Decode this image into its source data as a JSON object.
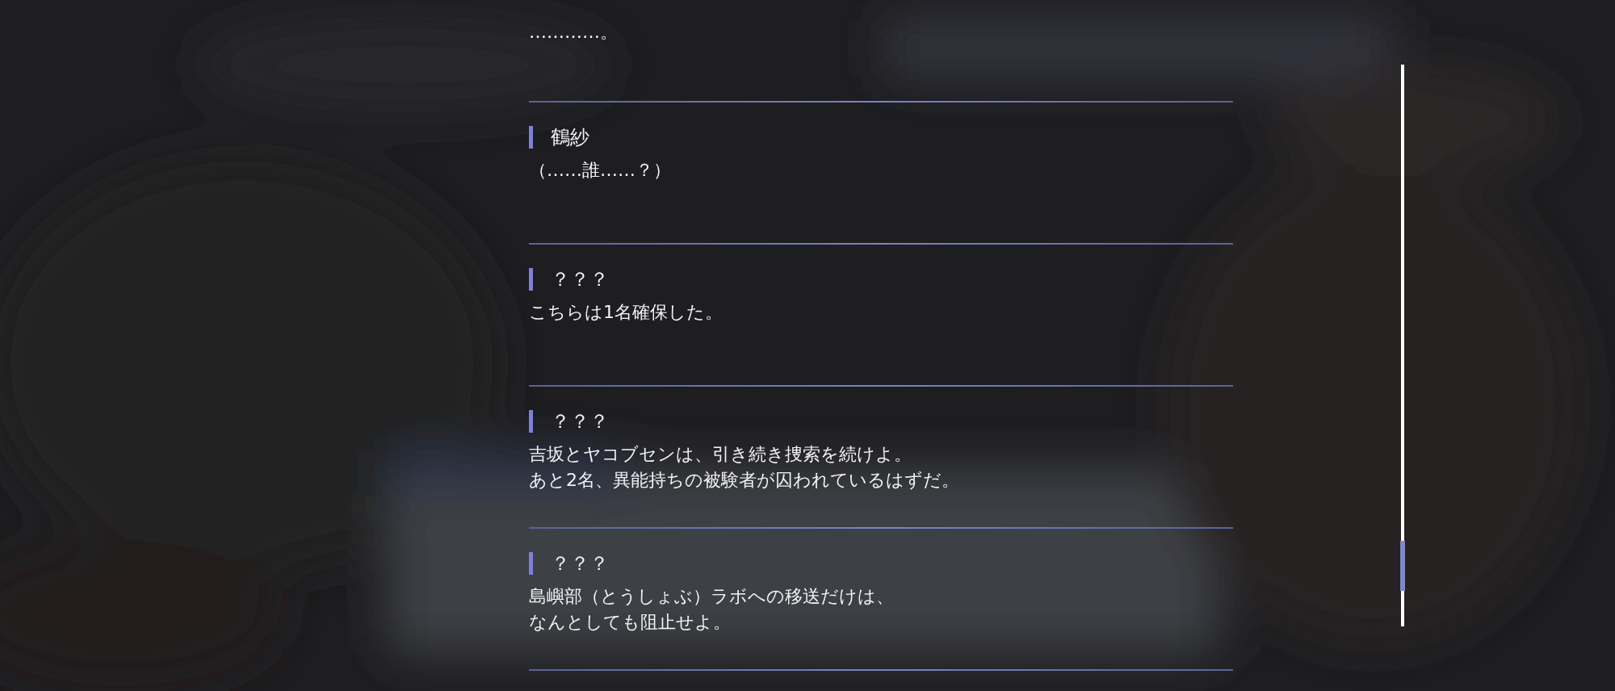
{
  "backlog": [
    {
      "lines": [
        "…………。"
      ]
    },
    {
      "name": "鶴紗",
      "lines": [
        "（……誰……？）"
      ]
    },
    {
      "name": "？？？",
      "lines": [
        "こちらは1名確保した。"
      ]
    },
    {
      "name": "？？？",
      "lines": [
        "吉坂とヤコブセンは、引き続き捜索を続けよ。",
        "あと2名、異能持ちの被験者が囚われているはずだ。"
      ]
    },
    {
      "name": "？？？",
      "lines": [
        "島嶼部（とうしょぶ）ラボへの移送だけは、",
        "なんとしても阻止せよ。"
      ]
    }
  ]
}
